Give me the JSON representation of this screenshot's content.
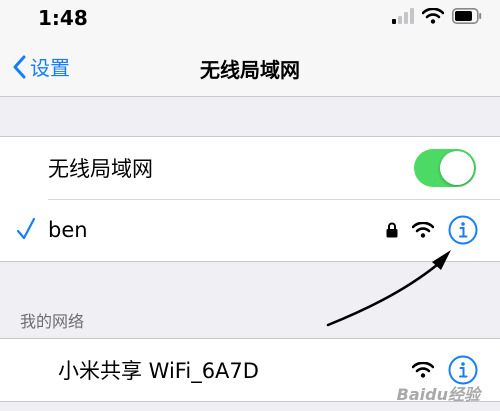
{
  "status_bar": {
    "time": "1:48",
    "icons": [
      "cellular-signal-icon",
      "wifi-icon",
      "battery-icon"
    ]
  },
  "nav": {
    "back_label": "设置",
    "title": "无线局域网"
  },
  "wifi_toggle": {
    "label": "无线局域网",
    "on": true
  },
  "connected_network": {
    "name": "ben",
    "checked": true,
    "icons": [
      "lock-icon",
      "wifi-icon",
      "info-icon"
    ]
  },
  "my_networks": {
    "header": "我的网络",
    "items": [
      {
        "name": "小米共享 WiFi_6A7D",
        "icons": [
          "wifi-icon",
          "info-icon"
        ]
      }
    ]
  },
  "colors": {
    "accent": "#147efb",
    "toggle_on": "#4cd964",
    "background": "#efeff4",
    "arrow": "#000000"
  },
  "watermark": "Baidu经验"
}
